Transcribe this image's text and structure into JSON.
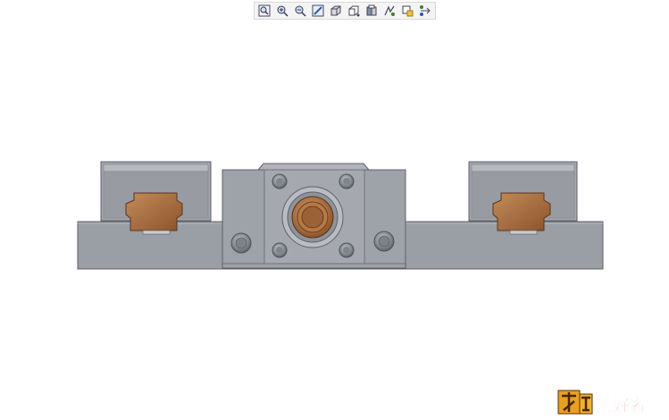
{
  "toolbar": {
    "buttons": [
      {
        "icon": "zoom-to-fit-icon"
      },
      {
        "icon": "zoom-in-icon"
      },
      {
        "icon": "zoom-out-icon"
      },
      {
        "icon": "zoom-to-area-icon"
      },
      {
        "icon": "view-orientation-icon"
      },
      {
        "icon": "display-style-icon"
      },
      {
        "icon": "section-view-icon"
      },
      {
        "icon": "hide-show-items-icon"
      },
      {
        "icon": "edit-appearance-icon"
      },
      {
        "icon": "apply-scene-icon"
      }
    ]
  },
  "colors": {
    "background": "#ffffff",
    "steel": "#9a9ea5",
    "steel_dark": "#6f737a",
    "steel_light": "#b4b8be",
    "bronze": "#a46a3e",
    "bronze_light": "#c48a58"
  },
  "watermark": {
    "label": "木工爱好者"
  }
}
